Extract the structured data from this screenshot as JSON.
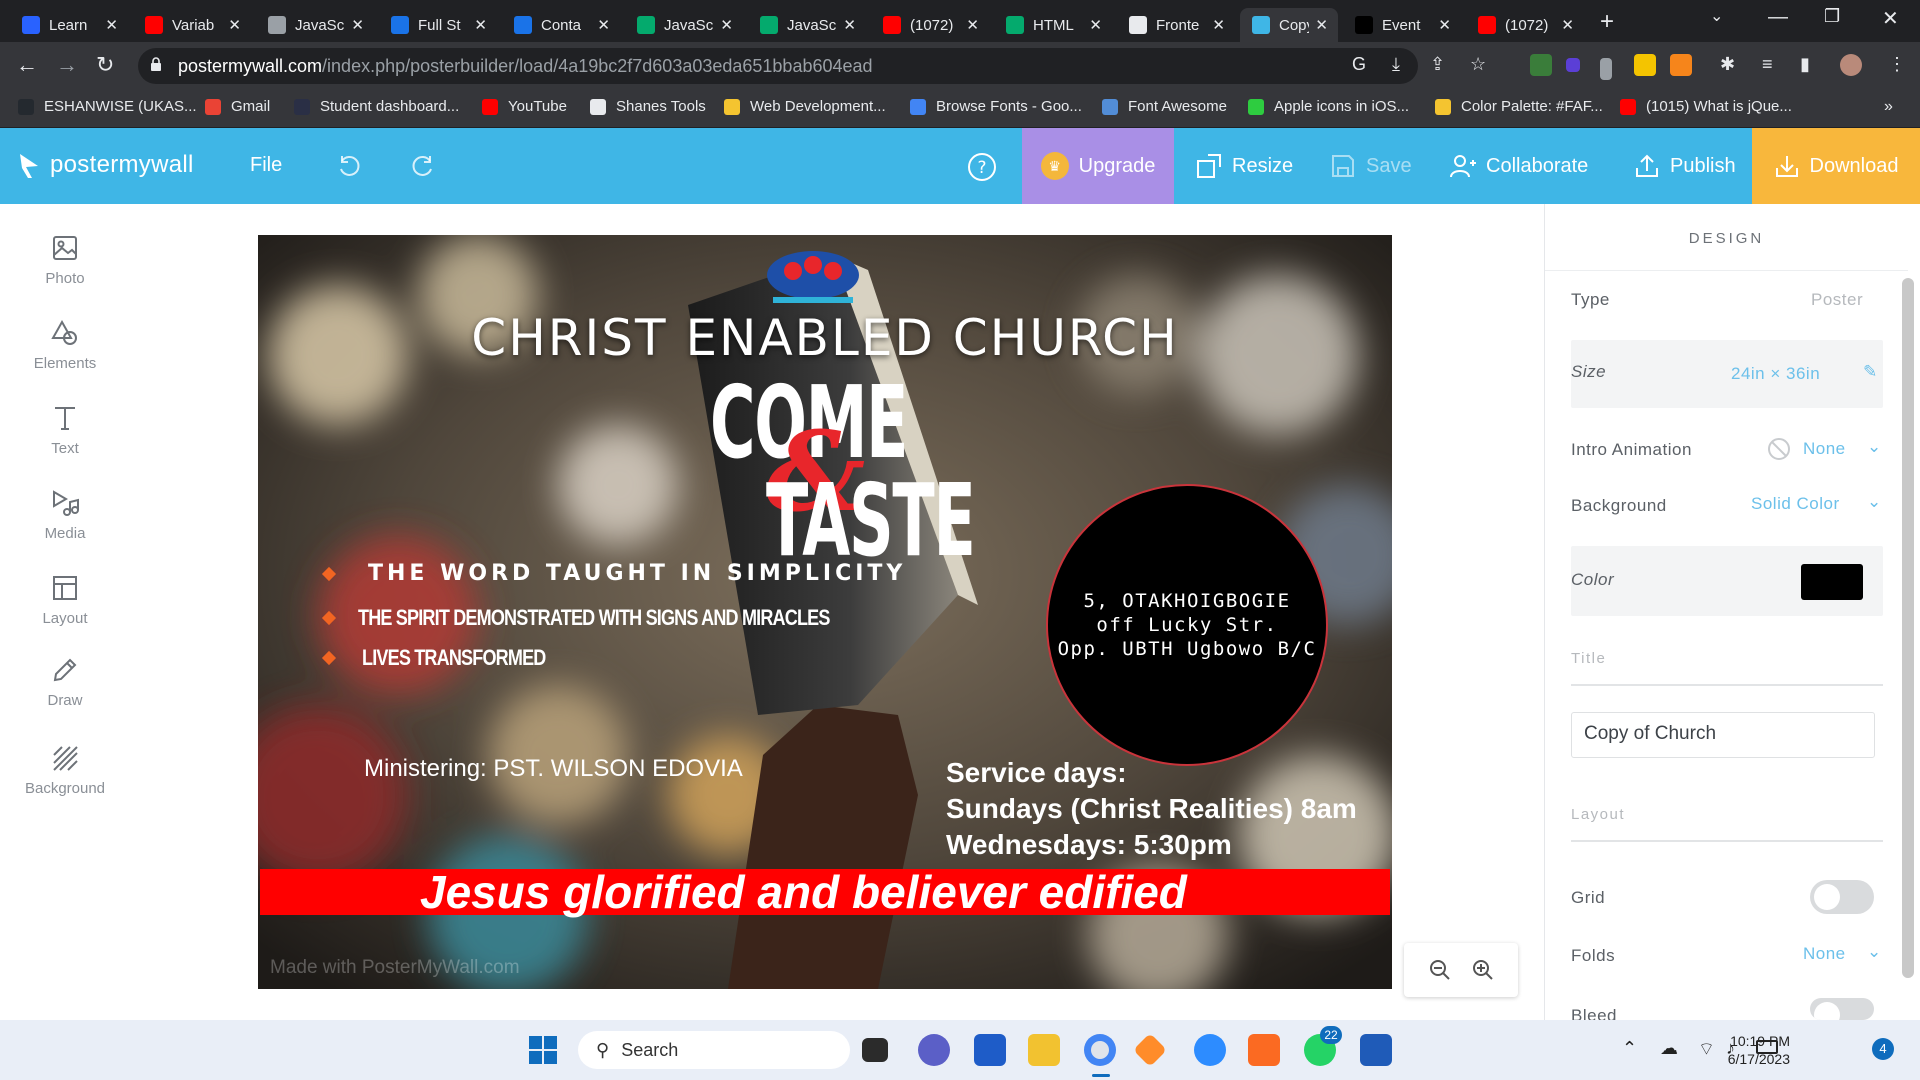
{
  "browser": {
    "tabs": [
      {
        "label": "Learn",
        "icon": "hashnode-icon",
        "color": "#2962ff"
      },
      {
        "label": "Variab",
        "icon": "youtube-icon",
        "color": "#ff0000"
      },
      {
        "label": "JavaSc",
        "icon": "globe-icon",
        "color": "#9aa0a6"
      },
      {
        "label": "Full St",
        "icon": "bookmark-blue-icon",
        "color": "#1a73e8"
      },
      {
        "label": "Conta",
        "icon": "bookmark-blue-icon",
        "color": "#1a73e8"
      },
      {
        "label": "JavaSc",
        "icon": "w3schools-icon",
        "color": "#04aa6d"
      },
      {
        "label": "JavaSc",
        "icon": "w3schools-icon",
        "color": "#04aa6d"
      },
      {
        "label": "(1072)",
        "icon": "youtube-icon",
        "color": "#ff0000"
      },
      {
        "label": "HTML",
        "icon": "w3schools-icon",
        "color": "#04aa6d"
      },
      {
        "label": "Fronte",
        "icon": "doc-icon",
        "color": "#e8eaed"
      },
      {
        "label": "Copy",
        "icon": "postermywall-icon",
        "color": "#3fb6e6"
      },
      {
        "label": "Event",
        "icon": "medium-icon",
        "color": "#000000"
      },
      {
        "label": "(1072)",
        "icon": "youtube-icon",
        "color": "#ff0000"
      }
    ],
    "active_tab": 10,
    "url_host": "postermywall.com",
    "url_path": "/index.php/posterbuilder/load/4a19bc2f7d603a03eda651bbab604ead",
    "bookmarks": [
      {
        "label": "ESHANWISE (UKAS...",
        "color": "#24292f"
      },
      {
        "label": "Gmail",
        "color": "#ea4335"
      },
      {
        "label": "Student dashboard...",
        "color": "#2a2f45"
      },
      {
        "label": "YouTube",
        "color": "#ff0000"
      },
      {
        "label": "Shanes Tools",
        "color": "#e8eaed"
      },
      {
        "label": "Web Development...",
        "color": "#f4c430"
      },
      {
        "label": "Browse Fonts - Goo...",
        "color": "#4285f4"
      },
      {
        "label": "Font Awesome",
        "color": "#528dd7"
      },
      {
        "label": "Apple icons in iOS...",
        "color": "#2ecc40"
      },
      {
        "label": "Color Palette: #FAF...",
        "color": "#f4c430"
      },
      {
        "label": "(1015) What is jQue...",
        "color": "#ff0000"
      }
    ],
    "more": "»"
  },
  "toolbar": {
    "logo": "postermywall",
    "file": "File",
    "upgrade": "Upgrade",
    "resize": "Resize",
    "save": "Save",
    "collaborate": "Collaborate",
    "publish": "Publish",
    "download": "Download",
    "colors": {
      "bar": "#3fb6e6",
      "upgrade": "#a98fe6",
      "download": "#f8b73c"
    }
  },
  "rail": [
    {
      "label": "Photo",
      "icon": "photo-icon"
    },
    {
      "label": "Elements",
      "icon": "shapes-icon"
    },
    {
      "label": "Text",
      "icon": "text-icon"
    },
    {
      "label": "Media",
      "icon": "media-icon"
    },
    {
      "label": "Layout",
      "icon": "layout-icon"
    },
    {
      "label": "Draw",
      "icon": "pencil-icon"
    },
    {
      "label": "Background",
      "icon": "hatch-icon"
    }
  ],
  "poster": {
    "church": "CHRIST ENABLED CHURCH",
    "come": "COME",
    "amp": "&",
    "taste": "TASTE",
    "bullets": [
      "THE WORD TAUGHT IN SIMPLICITY",
      "THE SPIRIT DEMONSTRATED WITH SIGNS AND MIRACLES",
      "LIVES TRANSFORMED"
    ],
    "address": [
      "5, OTAKHOIGBOGIE",
      "off Lucky Str.",
      "Opp. UBTH Ugbowo B/C"
    ],
    "minister": "Ministering: PST. WILSON EDOVIA",
    "service_title": "Service days:",
    "service_lines": [
      "Sundays (Christ Realities) 8am",
      "Wednesdays: 5:30pm"
    ],
    "banner": "Jesus glorified and believer edified",
    "watermark": "Made with PosterMyWall.com",
    "colors": {
      "banner": "#ff0000",
      "ampersand": "#e8262b",
      "bullet": "#f26522"
    }
  },
  "panel": {
    "title": "DESIGN",
    "type_label": "Type",
    "type_value": "Poster",
    "size_label": "Size",
    "size_value": "24in × 36in",
    "intro_label": "Intro Animation",
    "intro_value": "None",
    "bg_label": "Background",
    "bg_value": "Solid Color",
    "color_label": "Color",
    "color_value": "#000000",
    "title_section": "Title",
    "title_value": "Copy of Church",
    "layout_section": "Layout",
    "grid_label": "Grid",
    "folds_label": "Folds",
    "folds_value": "None",
    "bleed_label": "Bleed"
  },
  "taskbar": {
    "search": "Search",
    "whatsapp_badge": "22",
    "time": "10:19 PM",
    "date": "6/17/2023",
    "notification_count": "4"
  }
}
